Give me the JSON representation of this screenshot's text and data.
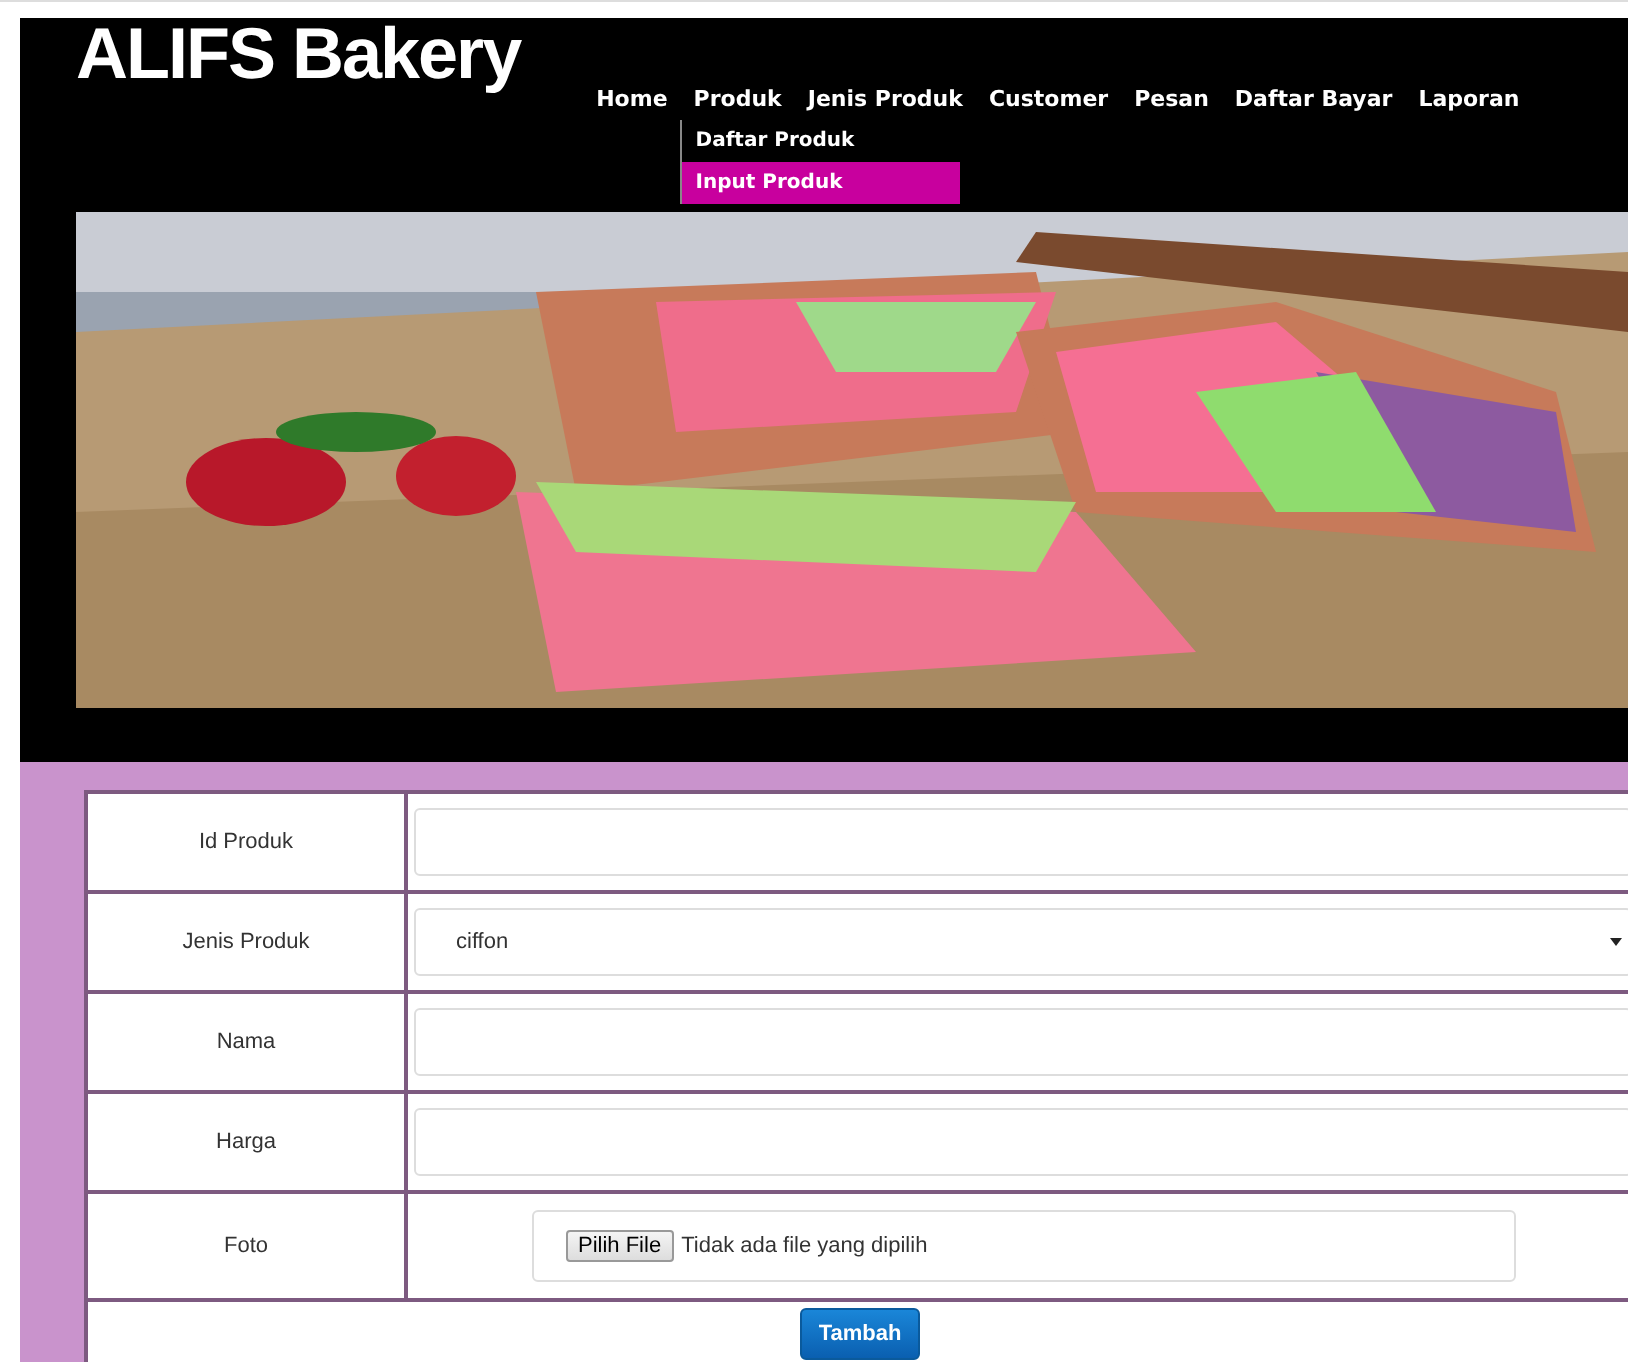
{
  "header": {
    "title": "ALIFS Bakery",
    "nav": [
      {
        "label": "Home"
      },
      {
        "label": "Produk",
        "children": [
          {
            "label": "Daftar Produk",
            "selected": false
          },
          {
            "label": "Input Produk",
            "selected": true
          }
        ]
      },
      {
        "label": "Jenis Produk"
      },
      {
        "label": "Customer"
      },
      {
        "label": "Pesan"
      },
      {
        "label": "Daftar Bayar"
      },
      {
        "label": "Laporan"
      }
    ]
  },
  "form": {
    "fields": [
      {
        "label": "Id Produk",
        "kind": "text"
      },
      {
        "label": "Jenis Produk",
        "kind": "select",
        "value": "ciffon"
      },
      {
        "label": "Nama",
        "kind": "text"
      },
      {
        "label": "Harga",
        "kind": "text"
      },
      {
        "label": "Foto",
        "kind": "file",
        "button": "Pilih File",
        "status": "Tidak ada file yang dipilih"
      }
    ],
    "submit": "Tambah"
  }
}
